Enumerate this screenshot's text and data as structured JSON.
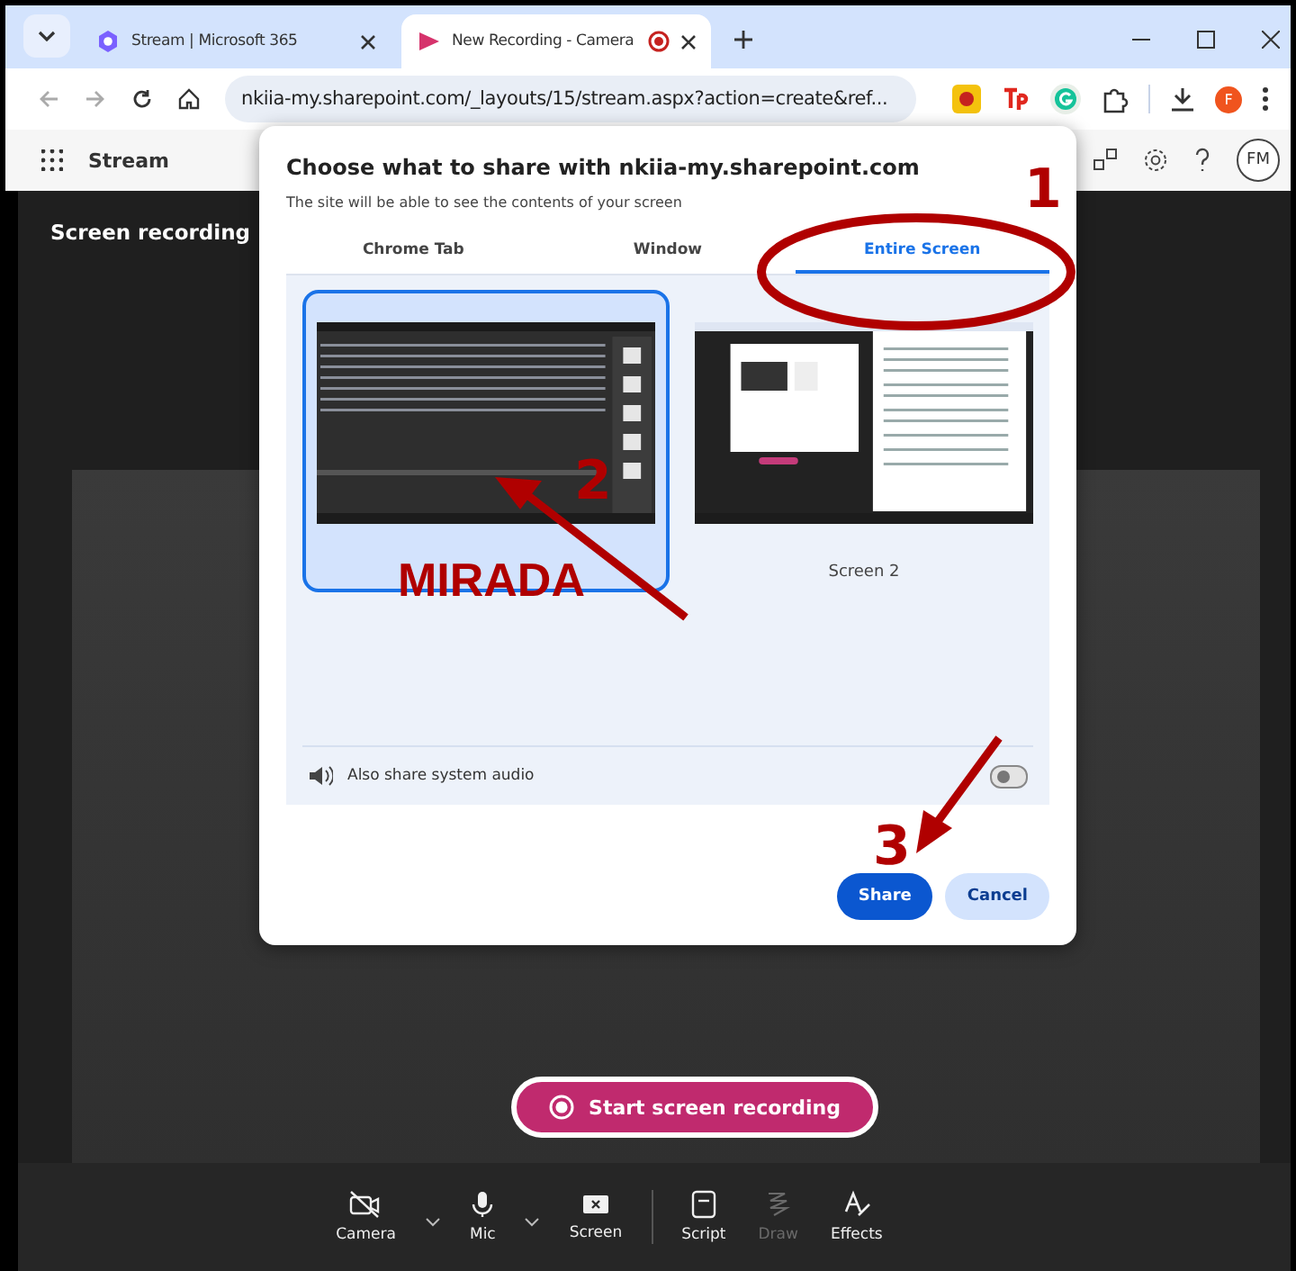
{
  "browser": {
    "tabs": [
      {
        "title": "Stream | Microsoft 365",
        "selected": false,
        "recording": false
      },
      {
        "title": "New Recording - Camera",
        "selected": true,
        "recording": true
      }
    ],
    "address": "nkiia-my.sharepoint.com/_layouts/15/stream.aspx?action=create&ref...",
    "profile_initial": "F"
  },
  "app": {
    "name": "Stream",
    "avatar": "FM",
    "page_title": "Screen recording",
    "record_button": "Start screen recording",
    "toolbar": [
      {
        "label": "Camera",
        "kind": "camera",
        "dropdown": true,
        "disabled": false
      },
      {
        "label": "Mic",
        "kind": "mic",
        "dropdown": true,
        "disabled": false
      },
      {
        "label": "Screen",
        "kind": "screen",
        "dropdown": false,
        "disabled": false
      },
      {
        "label": "Script",
        "kind": "script",
        "dropdown": false,
        "disabled": false
      },
      {
        "label": "Draw",
        "kind": "draw",
        "dropdown": false,
        "disabled": true
      },
      {
        "label": "Effects",
        "kind": "effects",
        "dropdown": false,
        "disabled": false
      }
    ]
  },
  "dialog": {
    "title": "Choose what to share with nkiia-my.sharepoint.com",
    "subtitle": "The site will be able to see the contents of your screen",
    "tabs": [
      {
        "label": "Chrome Tab",
        "selected": false
      },
      {
        "label": "Window",
        "selected": false
      },
      {
        "label": "Entire Screen",
        "selected": true
      }
    ],
    "screens": [
      {
        "selected": true,
        "kind": "dark"
      },
      {
        "label": "Screen 2",
        "selected": false,
        "kind": "split"
      }
    ],
    "audio": {
      "label": "Also share system audio",
      "on": false
    },
    "buttons": [
      {
        "label": "Share",
        "kind": "primary"
      },
      {
        "label": "Cancel",
        "kind": "secondary"
      }
    ]
  },
  "annotations": [
    {
      "kind": "number",
      "text": "1"
    },
    {
      "kind": "number",
      "text": "2"
    },
    {
      "kind": "number",
      "text": "3"
    },
    {
      "kind": "label",
      "text": "MIRADA"
    }
  ]
}
